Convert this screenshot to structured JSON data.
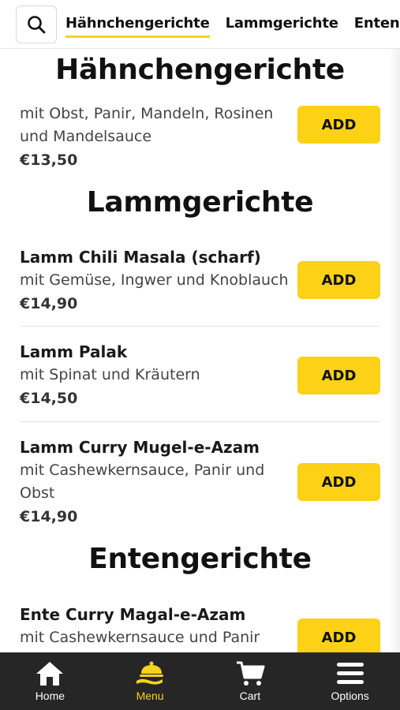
{
  "tabs": [
    "Hähnchengerichte",
    "Lammgerichte",
    "Entengerichte"
  ],
  "sections": {
    "chicken": {
      "title": "Hähnchengerichte",
      "items": [
        {
          "desc_line1": "mit Obst, Panir, Mandeln, Rosinen",
          "desc_line2": "und Mandelsauce",
          "price": "€13,50"
        }
      ]
    },
    "lamb": {
      "title": "Lammgerichte",
      "items": [
        {
          "name": "Lamm Chili Masala (scharf)",
          "desc_line1": "mit Gemüse, Ingwer und Knoblauch",
          "price": "€14,90"
        },
        {
          "name": "Lamm Palak",
          "desc_line1": "mit Spinat und Kräutern",
          "price": "€14,50"
        },
        {
          "name": "Lamm Curry Mugel-e-Azam",
          "desc_line1": "mit Cashewkernsauce, Panir und",
          "desc_line2": "Obst",
          "price": "€14,90"
        }
      ]
    },
    "duck": {
      "title": "Entengerichte",
      "items": [
        {
          "name": "Ente Curry Magal-e-Azam",
          "desc_line1": "mit Cashewkernsauce und Panir"
        }
      ]
    }
  },
  "add_label": "ADD",
  "nav": {
    "home": "Home",
    "menu": "Menu",
    "cart": "Cart",
    "options": "Options"
  },
  "colors": {
    "accent": "#fcd116",
    "nav_bg": "#262626"
  }
}
